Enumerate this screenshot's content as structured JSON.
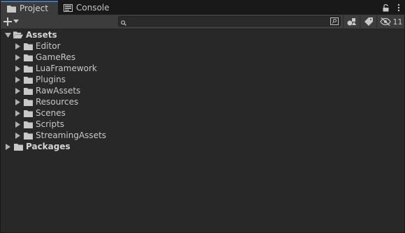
{
  "tabs": [
    {
      "label": "Project",
      "icon": "folder-icon",
      "active": true
    },
    {
      "label": "Console",
      "icon": "console-icon",
      "active": false
    }
  ],
  "tabbar_actions": {
    "lock": "lock-icon",
    "more": "more-icon"
  },
  "toolbar": {
    "create_label": "+",
    "search": {
      "value": "",
      "placeholder": ""
    },
    "hidden_count": "11"
  },
  "tree": {
    "assets": {
      "label": "Assets",
      "expanded": true,
      "children": [
        {
          "label": "Editor"
        },
        {
          "label": "GameRes"
        },
        {
          "label": "LuaFramework"
        },
        {
          "label": "Plugins"
        },
        {
          "label": "RawAssets"
        },
        {
          "label": "Resources"
        },
        {
          "label": "Scenes"
        },
        {
          "label": "Scripts"
        },
        {
          "label": "StreamingAssets"
        }
      ]
    },
    "packages": {
      "label": "Packages",
      "expanded": false
    }
  },
  "colors": {
    "panel": "#282828",
    "tabbar": "#191919",
    "active_tab": "#3c3c3c",
    "accent": "#3a79bb",
    "text": "#c4c4c4"
  }
}
